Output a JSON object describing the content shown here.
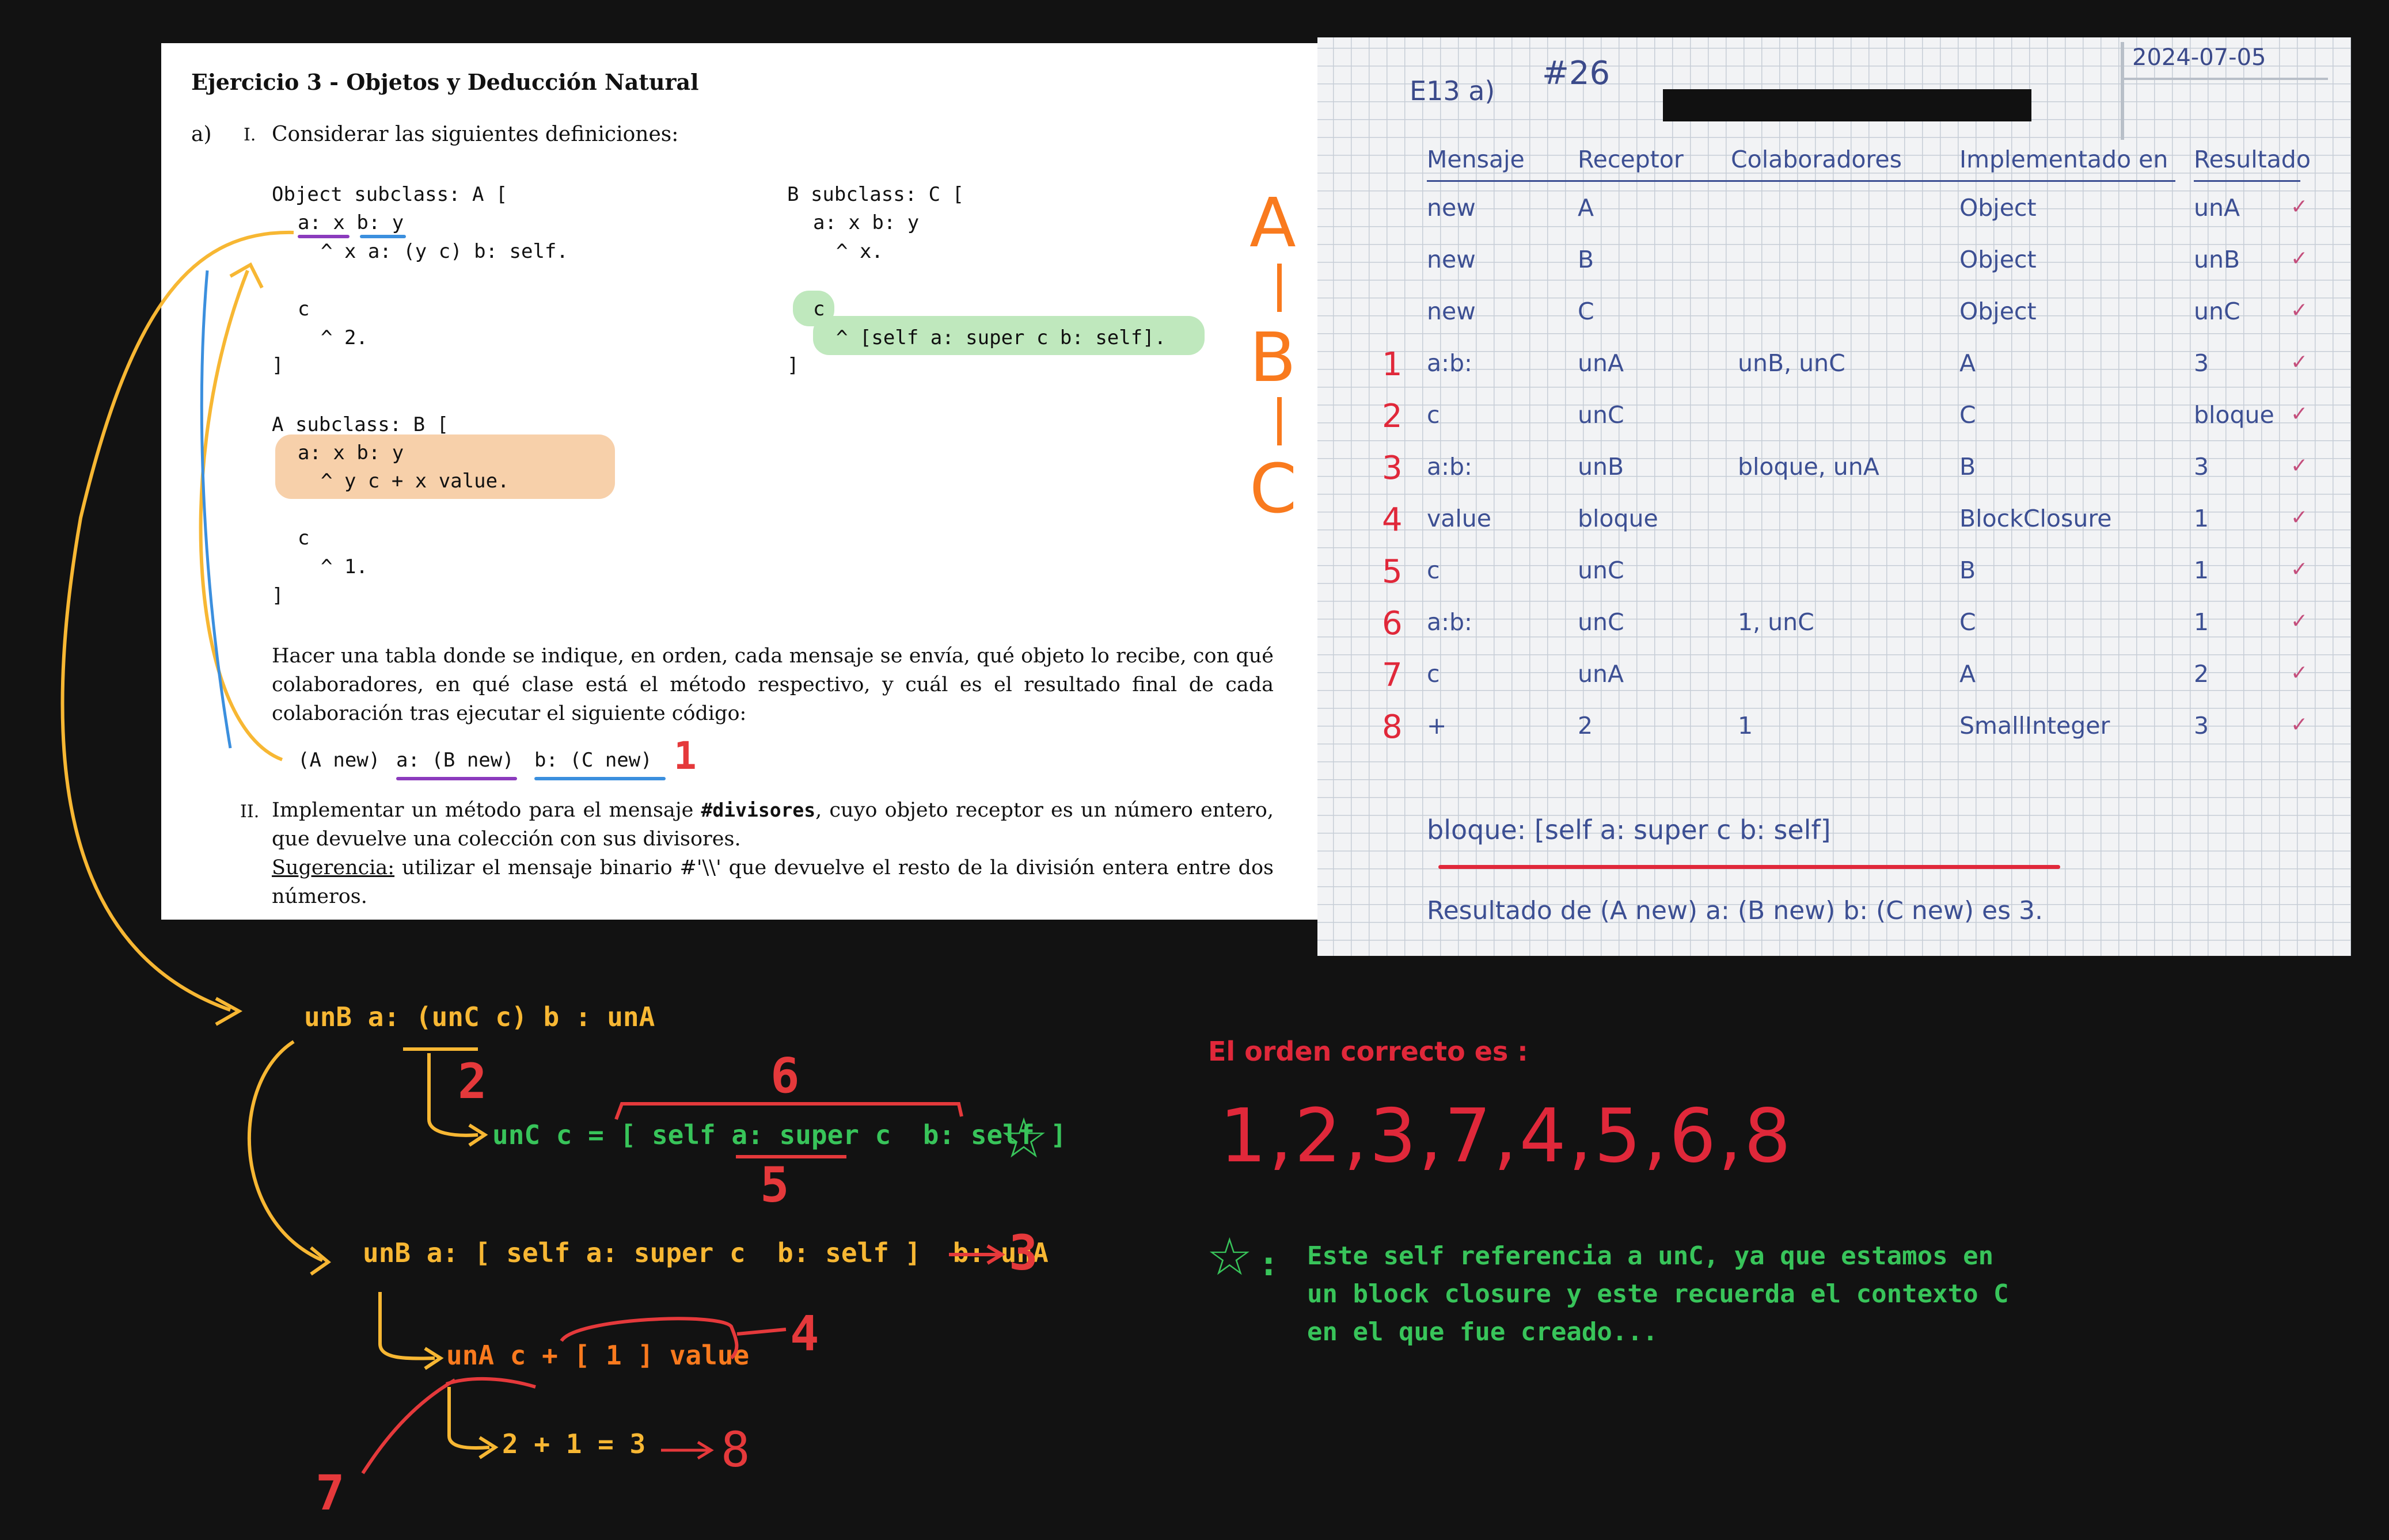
{
  "colors": {
    "background": "#121212",
    "yellow": "#f7b733",
    "green": "#38c45a",
    "orange": "#f97a1e",
    "red": "#e5393b",
    "ink": "#3c4f93"
  },
  "exercise": {
    "title": "Ejercicio 3 - Objetos y Deducción Natural",
    "part_a": "a)",
    "item_i": "I.",
    "item_i_text": "Considerar las siguientes definiciones:",
    "class_a": [
      "Object subclass: A [",
      "a: x b: y",
      "^ x a: (y c) b: self.",
      "c",
      "^ 2.",
      "]"
    ],
    "class_b": [
      "A subclass: B [",
      "a: x b: y",
      "^ y c + x value.",
      "c",
      "^ 1.",
      "]"
    ],
    "class_c": [
      "B subclass: C [",
      "a: x b: y",
      "^ x.",
      "c",
      "^ [self a: super c b: self].",
      "]"
    ],
    "instructions": "Hacer una tabla donde se indique, en orden, cada mensaje se envía, qué objeto lo recibe, con qué colaboradores, en qué clase está el método respectivo, y cuál es el resultado final de cada colaboración tras ejecutar el siguiente código:",
    "code_parts": [
      "(A new)",
      "a: (B new)",
      "b: (C new)"
    ],
    "item_ii": "II.",
    "item_ii_text_1": "Implementar un método para el mensaje ",
    "item_ii_bold": "#divisores",
    "item_ii_text_2": ", cuyo objeto receptor es un número entero, que devuelve una colección con sus divisores.",
    "hint_label": "Sugerencia:",
    "hint_text": " utilizar el mensaje binario #'\\\\' que devuelve el resto de la división entera entre dos números."
  },
  "hierarchy": {
    "a": "A",
    "b": "B",
    "c": "C"
  },
  "notebook": {
    "label": "E13 a)",
    "number": "#26",
    "date": "2024-07-05",
    "headers": [
      "Mensaje",
      "Receptor",
      "Colaboradores",
      "Implementado en",
      "Resultado"
    ],
    "rows": [
      {
        "n": "",
        "msg": "new",
        "rec": "A",
        "col": "",
        "impl": "Object",
        "res": "unA"
      },
      {
        "n": "",
        "msg": "new",
        "rec": "B",
        "col": "",
        "impl": "Object",
        "res": "unB"
      },
      {
        "n": "",
        "msg": "new",
        "rec": "C",
        "col": "",
        "impl": "Object",
        "res": "unC"
      },
      {
        "n": "1",
        "msg": "a:b:",
        "rec": "unA",
        "col": "unB, unC",
        "impl": "A",
        "res": "3"
      },
      {
        "n": "2",
        "msg": "c",
        "rec": "unC",
        "col": "",
        "impl": "C",
        "res": "bloque"
      },
      {
        "n": "3",
        "msg": "a:b:",
        "rec": "unB",
        "col": "bloque, unA",
        "impl": "B",
        "res": "3"
      },
      {
        "n": "4",
        "msg": "value",
        "rec": "bloque",
        "col": "",
        "impl": "BlockClosure",
        "res": "1"
      },
      {
        "n": "5",
        "msg": "c",
        "rec": "unC",
        "col": "",
        "impl": "B",
        "res": "1"
      },
      {
        "n": "6",
        "msg": "a:b:",
        "rec": "unC",
        "col": "1, unC",
        "impl": "C",
        "res": "1"
      },
      {
        "n": "7",
        "msg": "c",
        "rec": "unA",
        "col": "",
        "impl": "A",
        "res": "2"
      },
      {
        "n": "8",
        "msg": "+",
        "rec": "2",
        "col": "1",
        "impl": "SmallInteger",
        "res": "3"
      }
    ],
    "bloque_def": "bloque: [self a: super c b: self]",
    "result_line": "Resultado de (A new) a: (B new) b: (C new) es 3."
  },
  "trace": {
    "line1_prefix": "unB a: ",
    "line1_call": "(unC c)",
    "line1_suffix": " b : unA",
    "line2_left": "unC c",
    "line2_eq": " = [ self a: ",
    "line2_super": "super c",
    "line2_end": "  b: self ]",
    "line3": "unB a: [ self a: super c  b: self ]  b: unA",
    "line4_prefix": "unA c",
    "line4_rest": " + [ 1 ] value",
    "line5": "2 + 1 = 3",
    "labels": {
      "l1": "1",
      "l2": "2",
      "l3": "3",
      "l4": "4",
      "l5": "5",
      "l6": "6",
      "l7": "7",
      "l8": "8"
    }
  },
  "order": {
    "heading": "El orden correcto es :",
    "sequence": "1,2,3,7,4,5,6,8"
  },
  "note": {
    "mark": ":",
    "text": "Este self referencia a unC, ya que estamos en un block closure y este recuerda el contexto C en el que fue creado..."
  }
}
